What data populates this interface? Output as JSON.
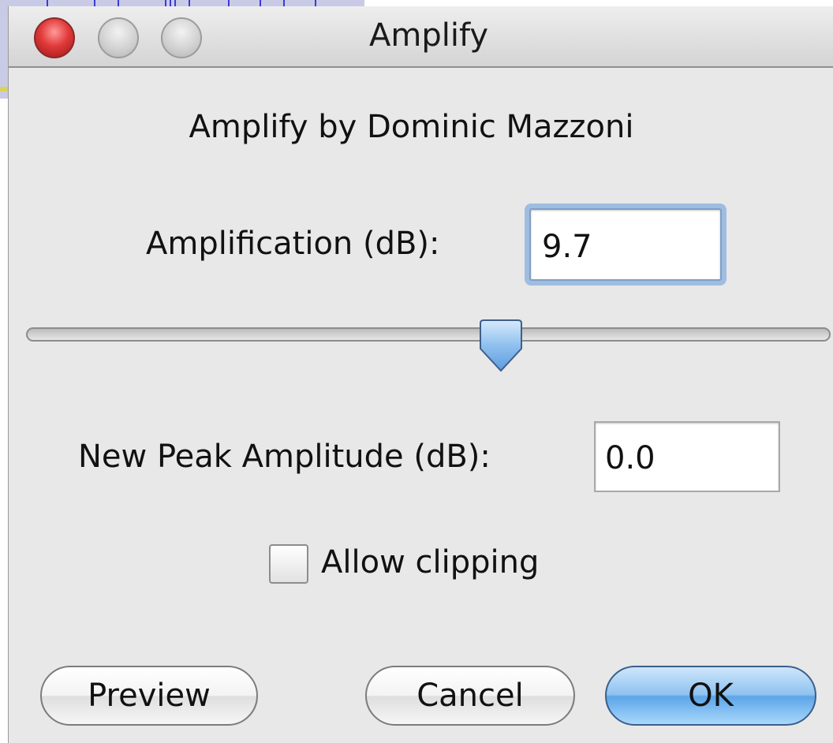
{
  "window": {
    "title": "Amplify"
  },
  "dialog": {
    "heading": "Amplify by Dominic Mazzoni",
    "amplification": {
      "label": "Amplification (dB):",
      "value": "9.7"
    },
    "slider": {
      "position_fraction": 0.6
    },
    "new_peak": {
      "label": "New Peak Amplitude (dB):",
      "value": "0.0"
    },
    "allow_clipping": {
      "label": "Allow clipping",
      "checked": false
    },
    "buttons": {
      "preview": "Preview",
      "cancel": "Cancel",
      "ok": "OK"
    }
  },
  "icons": {
    "close": "close-icon",
    "minimize": "minimize-icon",
    "zoom": "zoom-icon",
    "slider_thumb": "slider-thumb-icon"
  },
  "colors": {
    "default_button": "#5ca5e8",
    "focus_ring": "#9fbde0",
    "close_button": "#e23a3a"
  }
}
